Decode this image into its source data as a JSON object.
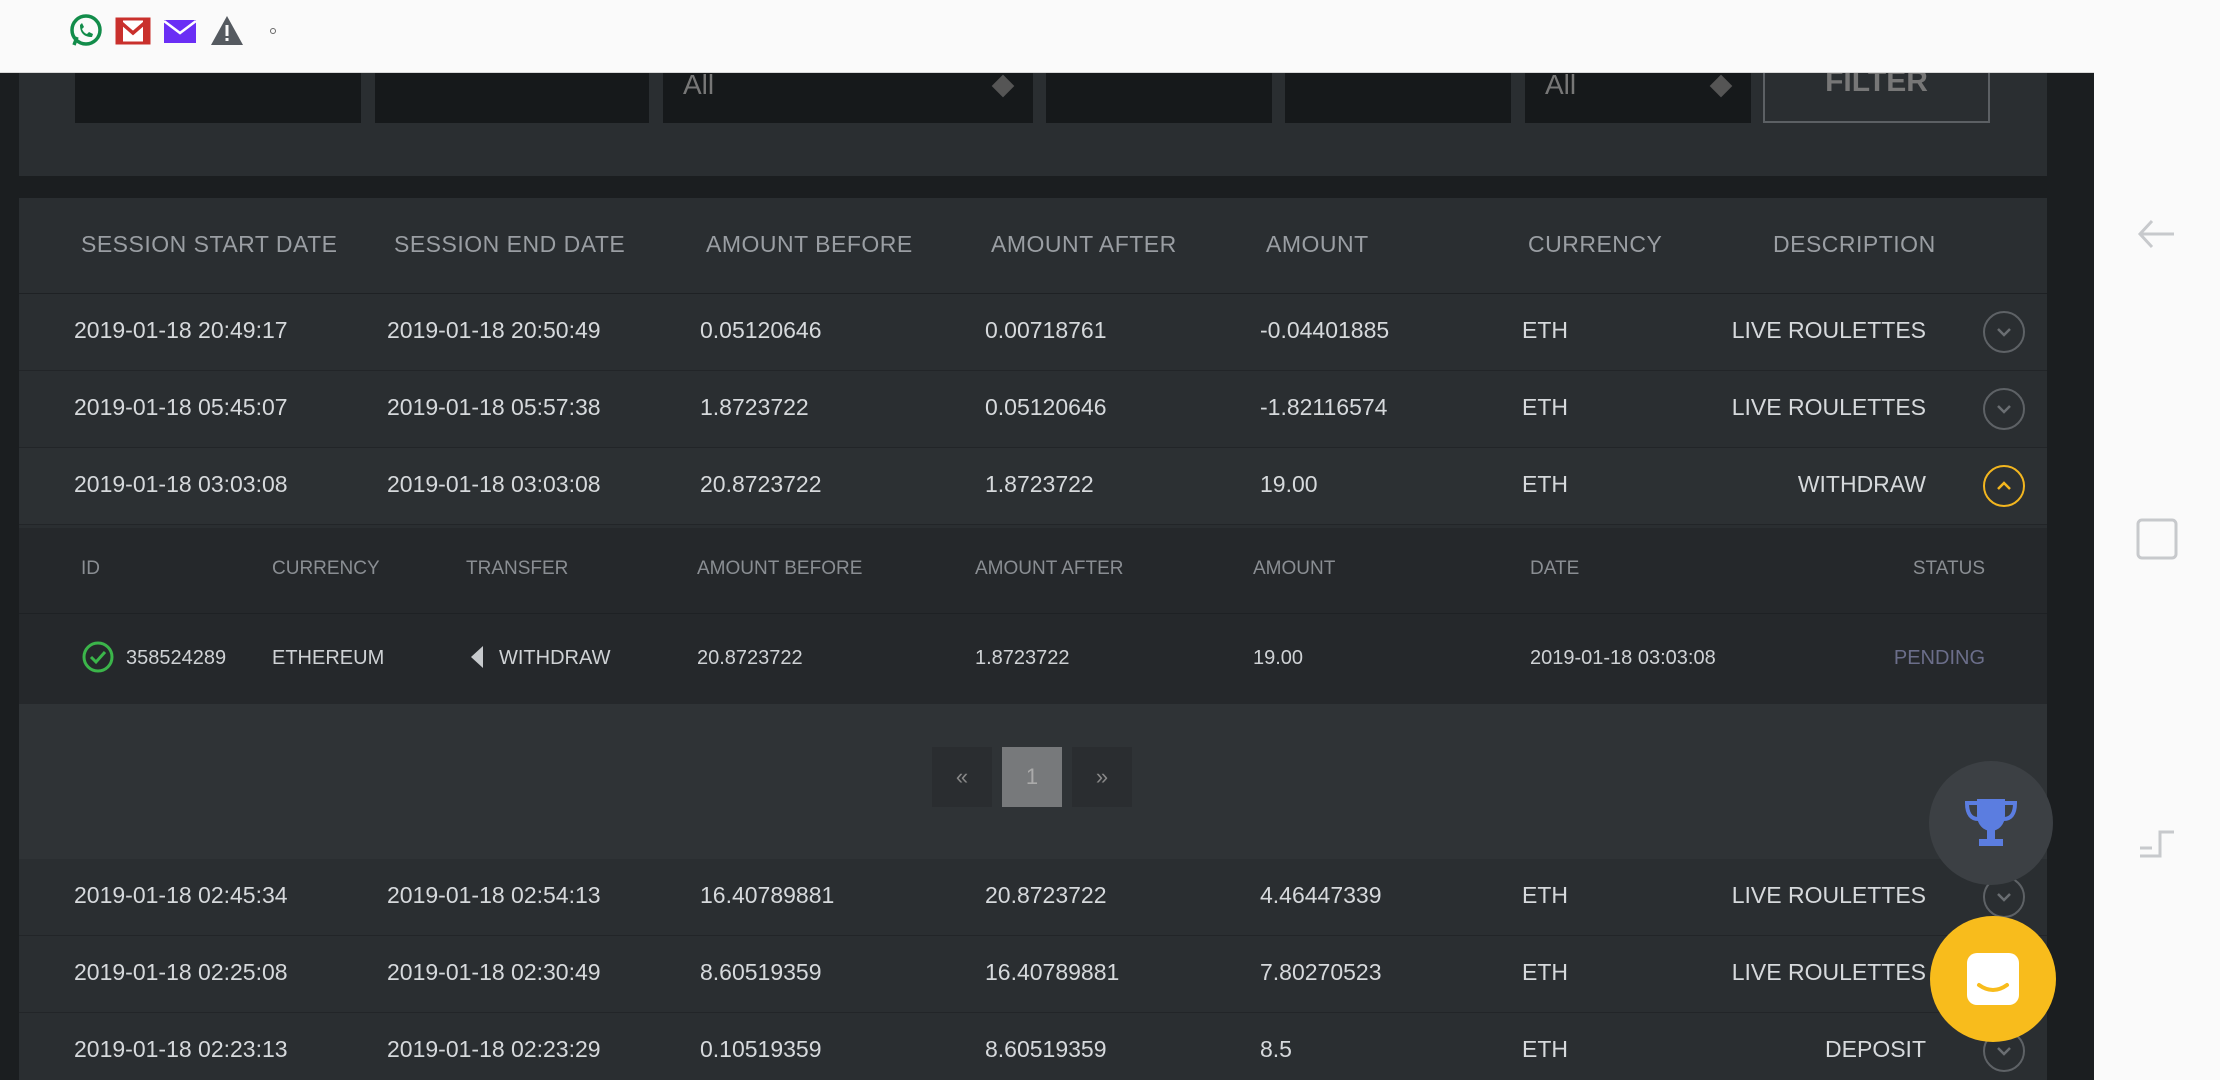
{
  "status_bar": {
    "icons": [
      "whatsapp-icon",
      "gmail-icon",
      "mail-icon",
      "warning-icon",
      "dot-icon"
    ]
  },
  "filters": {
    "select1_value": "All",
    "select2_value": "All",
    "button_label": "FILTER"
  },
  "table": {
    "columns": [
      "SESSION START DATE",
      "SESSION END DATE",
      "AMOUNT BEFORE",
      "AMOUNT AFTER",
      "AMOUNT",
      "CURRENCY",
      "DESCRIPTION"
    ],
    "rows": [
      {
        "start": "2019-01-18 20:49:17",
        "end": "2019-01-18 20:50:49",
        "before": "0.05120646",
        "after": "0.00718761",
        "amount": "-0.04401885",
        "currency": "ETH",
        "description": "LIVE ROULETTES"
      },
      {
        "start": "2019-01-18 05:45:07",
        "end": "2019-01-18 05:57:38",
        "before": "1.8723722",
        "after": "0.05120646",
        "amount": "-1.82116574",
        "currency": "ETH",
        "description": "LIVE ROULETTES"
      },
      {
        "start": "2019-01-18 03:03:08",
        "end": "2019-01-18 03:03:08",
        "before": "20.8723722",
        "after": "1.8723722",
        "amount": "19.00",
        "currency": "ETH",
        "description": "WITHDRAW"
      },
      {
        "start": "2019-01-18 02:45:34",
        "end": "2019-01-18 02:54:13",
        "before": "16.40789881",
        "after": "20.8723722",
        "amount": "4.46447339",
        "currency": "ETH",
        "description": "LIVE ROULETTES"
      },
      {
        "start": "2019-01-18 02:25:08",
        "end": "2019-01-18 02:30:49",
        "before": "8.60519359",
        "after": "16.40789881",
        "amount": "7.80270523",
        "currency": "ETH",
        "description": "LIVE ROULETTES"
      },
      {
        "start": "2019-01-18 02:23:13",
        "end": "2019-01-18 02:23:29",
        "before": "0.10519359",
        "after": "8.60519359",
        "amount": "8.5",
        "currency": "ETH",
        "description": "DEPOSIT"
      }
    ]
  },
  "detail": {
    "columns": [
      "ID",
      "CURRENCY",
      "TRANSFER",
      "AMOUNT BEFORE",
      "AMOUNT AFTER",
      "AMOUNT",
      "DATE",
      "STATUS"
    ],
    "row": {
      "id": "358524289",
      "currency": "ETHEREUM",
      "transfer": "WITHDRAW",
      "before": "20.8723722",
      "after": "1.8723722",
      "amount": "19.00",
      "date": "2019-01-18 03:03:08",
      "status": "PENDING"
    }
  },
  "pager": {
    "prev": "«",
    "page": "1",
    "next": "»"
  },
  "colors": {
    "accent": "#f3b61f",
    "trophy": "#5b7de0",
    "success": "#3bb54a",
    "pending": "#6b6e8a"
  }
}
